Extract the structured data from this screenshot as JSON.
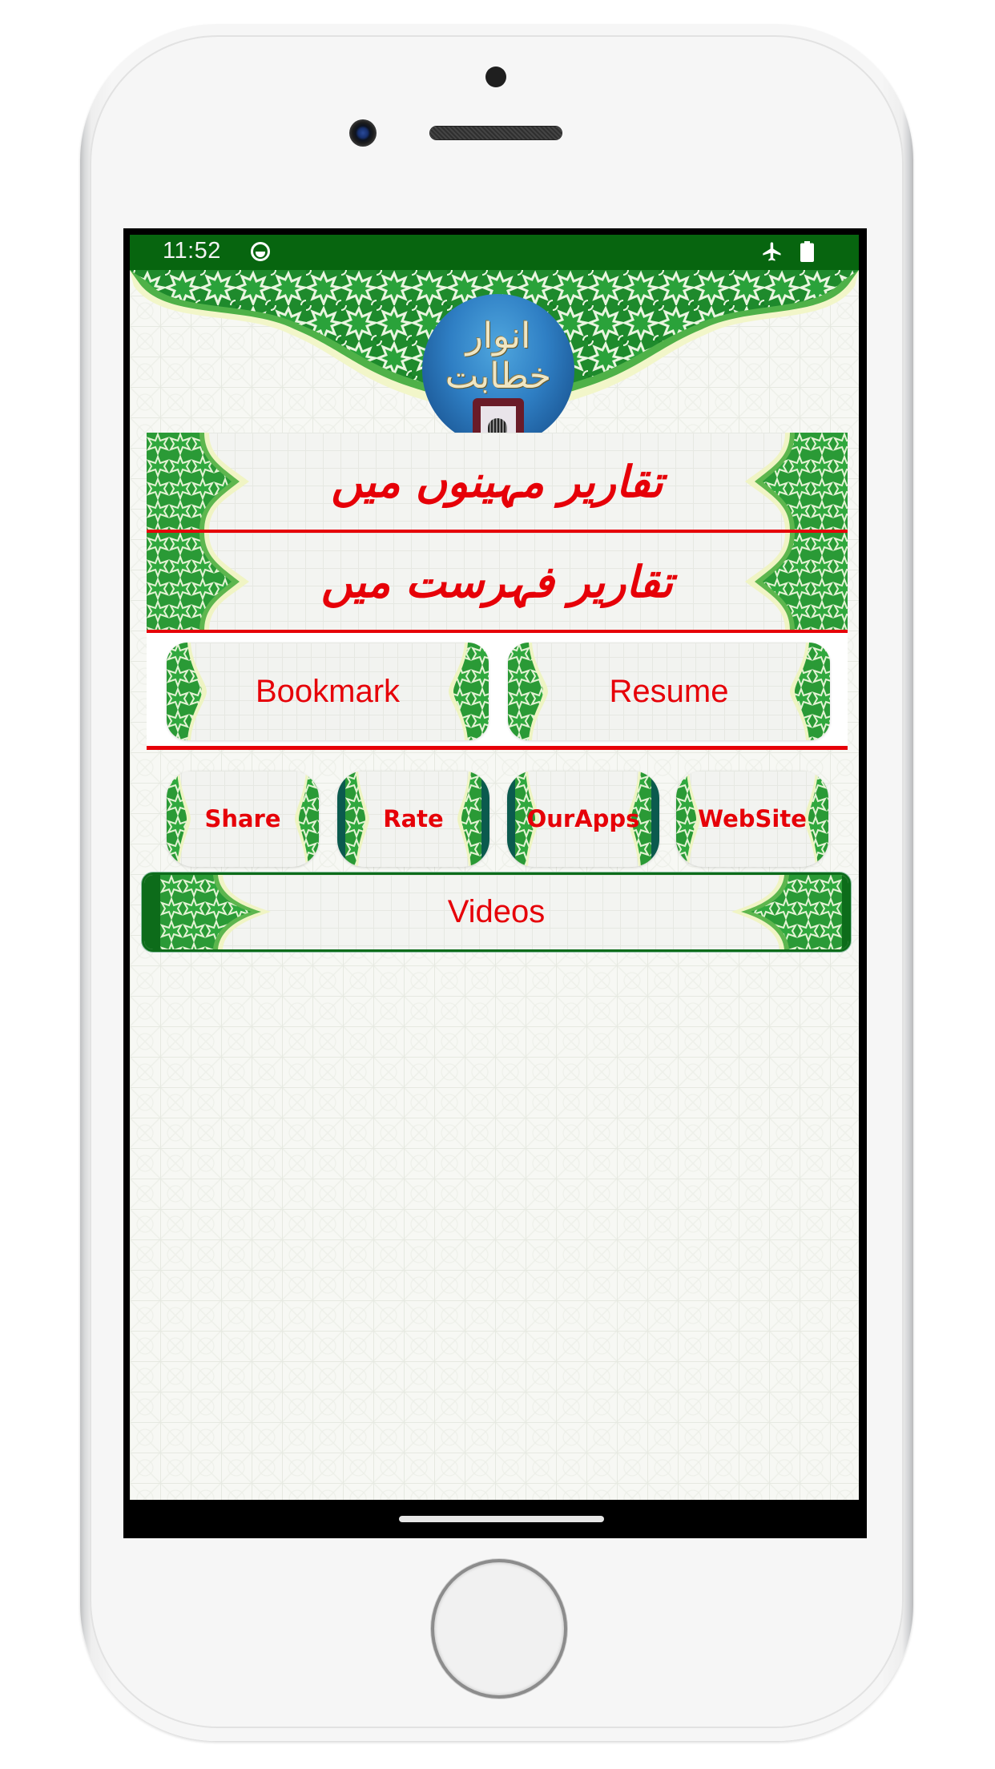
{
  "status_bar": {
    "time": "11:52",
    "notification_icon": "face-mask-icon",
    "airplane_icon": "airplane-mode-icon",
    "battery_icon": "battery-full-icon"
  },
  "header": {
    "logo_title": "انوار خطابت",
    "logo_icon": "podium-microphone-icon"
  },
  "menu": {
    "items": [
      {
        "label": "تقاریر مہینوں میں"
      },
      {
        "label": "تقاریر فہرست میں"
      }
    ]
  },
  "actions_primary": {
    "bookmark": "Bookmark",
    "resume": "Resume"
  },
  "actions_secondary": {
    "share": "Share",
    "rate": "Rate",
    "our_apps": "OurApps",
    "website": "WebSite"
  },
  "videos": {
    "label": "Videos"
  },
  "colors": {
    "status_bar": "#07650f",
    "accent_red": "#e60008",
    "pattern_green": "#2e9a3a",
    "teal": "#0b5a4e"
  }
}
